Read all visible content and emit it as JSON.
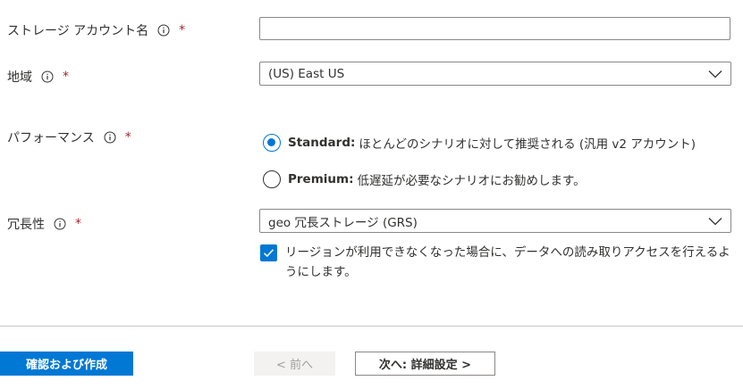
{
  "fields": {
    "account_name": {
      "label": "ストレージ アカウント名",
      "required_mark": "*",
      "value": ""
    },
    "region": {
      "label": "地域",
      "required_mark": "*",
      "selected": "(US) East US"
    },
    "performance": {
      "label": "パフォーマンス",
      "required_mark": "*",
      "options": [
        {
          "bold": "Standard:",
          "text": "ほとんどのシナリオに対して推奨される (汎用 v2 アカウント)",
          "checked": true
        },
        {
          "bold": "Premium:",
          "text": "低遅延が必要なシナリオにお勧めします。",
          "checked": false
        }
      ]
    },
    "redundancy": {
      "label": "冗長性",
      "required_mark": "*",
      "selected": "geo 冗長ストレージ (GRS)",
      "checkbox_text": "リージョンが利用できなくなった場合に、データへの読み取りアクセスを行えるようにします。",
      "checkbox_checked": true
    }
  },
  "footer": {
    "review_create": "確認および作成",
    "previous": "< 前へ",
    "next": "次へ: 詳細設定 >"
  },
  "colors": {
    "accent": "#0078d4",
    "required": "#a4262c",
    "border": "#8a8886",
    "text": "#323130",
    "disabled_text": "#a19f9d",
    "disabled_bg": "#f3f2f1"
  },
  "icons": [
    "info-icon",
    "chevron-down-icon",
    "checkmark-icon"
  ]
}
